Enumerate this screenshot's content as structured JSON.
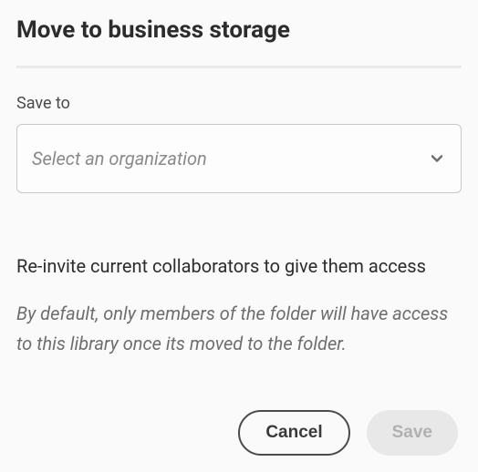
{
  "title": "Move to business storage",
  "save_to_label": "Save to",
  "select_placeholder": "Select an organization",
  "reinvite_heading": "Re-invite current collaborators to give them access",
  "description": "By default, only members of the folder will have access to this library once its moved to the folder.",
  "buttons": {
    "cancel": "Cancel",
    "save": "Save"
  }
}
